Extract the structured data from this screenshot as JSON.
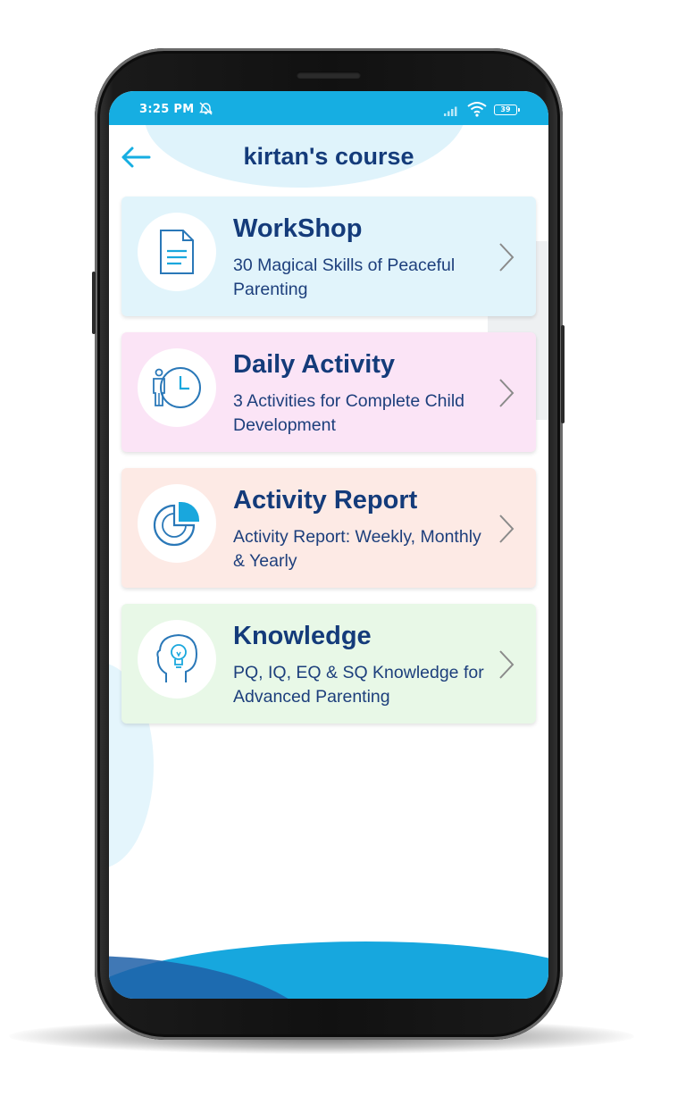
{
  "status_bar": {
    "time": "3:25 PM",
    "battery": "39",
    "icons": [
      "alarm-off-icon",
      "signal-icon",
      "wifi-icon",
      "battery-icon"
    ]
  },
  "header": {
    "title": "kirtan's course",
    "back_icon": "arrow-left-icon"
  },
  "cards": [
    {
      "title": "WorkShop",
      "subtitle": "30 Magical Skills of Peaceful Parenting",
      "icon": "document-icon",
      "bg_color": "#e1f4fb"
    },
    {
      "title": "Daily Activity",
      "subtitle": "3 Activities for Complete Child Development",
      "icon": "person-clock-icon",
      "bg_color": "#fbe4f6"
    },
    {
      "title": "Activity Report",
      "subtitle": "Activity Report: Weekly, Monthly & Yearly",
      "icon": "pie-chart-icon",
      "bg_color": "#fdeae5"
    },
    {
      "title": "Knowledge",
      "subtitle": "PQ, IQ, EQ & SQ Knowledge for Advanced Parenting",
      "icon": "head-bulb-icon",
      "bg_color": "#e8f8e7"
    }
  ],
  "colors": {
    "accent": "#16aee2",
    "title_text": "#143b7a",
    "wave_dark": "#1f60a8"
  }
}
